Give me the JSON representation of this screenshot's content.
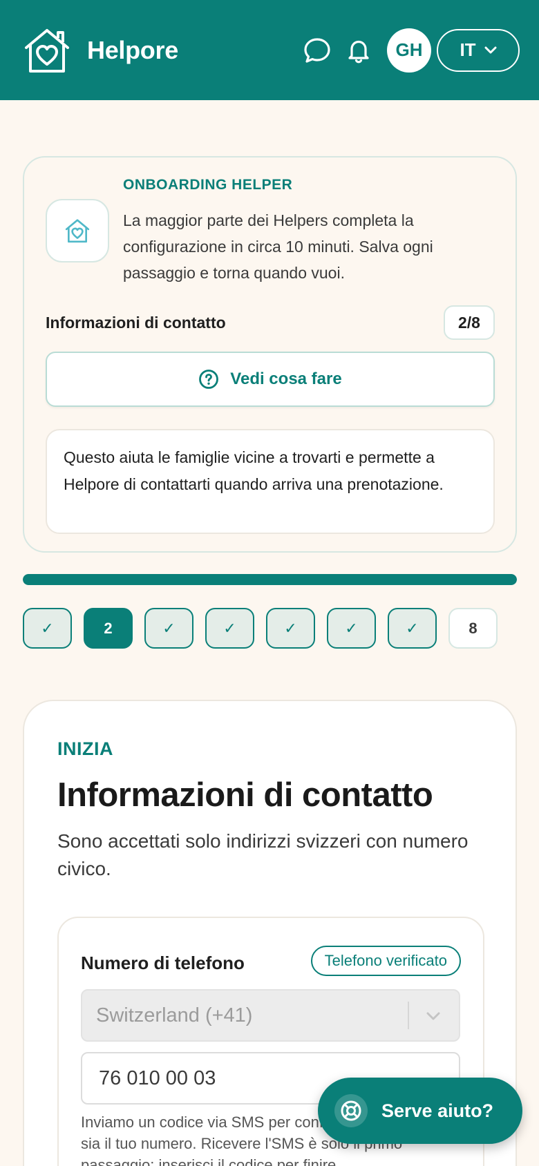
{
  "header": {
    "brand": "Helpore",
    "avatar_initials": "GH",
    "language": "IT",
    "icons": [
      "house-heart-icon",
      "chat-icon",
      "bell-icon",
      "chevron-down-icon"
    ]
  },
  "onboarding": {
    "label": "ONBOARDING HELPER",
    "description": "La maggior parte dei Helpers completa la configurazione in circa 10 minuti. Salva ogni passaggio e torna quando vuoi.",
    "step_title": "Informazioni di contatto",
    "step_count": "2/8",
    "see_button": "Vedi cosa fare",
    "note": "Questo aiuta le famiglie vicine a trovarti e permette a Helpore di contattarti quando arriva una prenotazione."
  },
  "progress": {
    "fraction": 1.0,
    "steps": [
      {
        "label": "✓",
        "state": "done"
      },
      {
        "label": "2",
        "state": "current"
      },
      {
        "label": "✓",
        "state": "done"
      },
      {
        "label": "✓",
        "state": "done"
      },
      {
        "label": "✓",
        "state": "done"
      },
      {
        "label": "✓",
        "state": "done"
      },
      {
        "label": "✓",
        "state": "done"
      },
      {
        "label": "8",
        "state": "todo"
      }
    ]
  },
  "form": {
    "kicker": "INIZIA",
    "title": "Informazioni di contatto",
    "subtitle": "Sono accettati solo indirizzi svizzeri con numero civico.",
    "phone": {
      "label": "Numero di telefono",
      "verified_badge": "Telefono verificato",
      "country": "Switzerland (+41)",
      "number": "76 010 00 03",
      "help": "Inviamo un codice via SMS per confermare che questo sia il tuo numero. Ricevere l'SMS è solo il primo passaggio: inserisci il codice per finire."
    }
  },
  "help_fab": {
    "label": "Serve aiuto?"
  },
  "colors": {
    "brand": "#0a7f78",
    "background": "#fdf7f0"
  }
}
